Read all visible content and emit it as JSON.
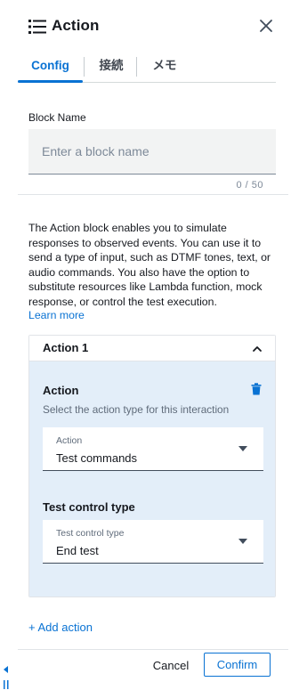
{
  "header": {
    "title": "Action",
    "title_icon": "list-icon",
    "close_icon": "close-icon"
  },
  "tabs": [
    {
      "label": "Config",
      "active": true
    },
    {
      "label": "接続",
      "active": false
    },
    {
      "label": "メモ",
      "active": false
    }
  ],
  "block_name": {
    "label": "Block Name",
    "placeholder": "Enter a block name",
    "value": "",
    "char_count": "0 / 50"
  },
  "description": {
    "text": "The Action block enables you to simulate responses to observed events. You can use it to send a type of input, such as DTMF tones, text, or audio commands. You also have the option to substitute resources like Lambda function, mock response, or control the test execution.",
    "learn_more": "Learn more"
  },
  "actions": [
    {
      "title": "Action 1",
      "expanded": true,
      "action_section": {
        "title": "Action",
        "subtitle": "Select the action type for this interaction",
        "select_label": "Action",
        "select_value": "Test commands"
      },
      "control_section": {
        "title": "Test control type",
        "select_label": "Test control type",
        "select_value": "End test"
      }
    }
  ],
  "add_action_label": "+ Add action",
  "footer": {
    "cancel_label": "Cancel",
    "confirm_label": "Confirm"
  },
  "colors": {
    "accent": "#0972d3",
    "card_body_bg": "#e3eef9",
    "input_bg": "#f2f3f3",
    "text": "#16191f",
    "muted_text": "#5f6b7a"
  }
}
